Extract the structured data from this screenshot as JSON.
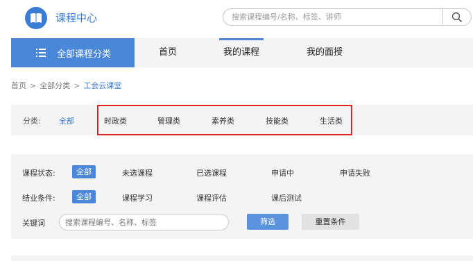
{
  "header": {
    "title": "课程中心",
    "search_placeholder": "搜索课程编号/名称、标签、讲师",
    "logo_icon": "book-icon",
    "search_icon": "search-icon"
  },
  "nav": {
    "all_categories": "全部课程分类",
    "menu_icon": "list-menu-icon",
    "items": [
      "首页",
      "我的课程",
      "我的面授"
    ],
    "active": "我的课程"
  },
  "breadcrumb": [
    "首页",
    "全部分类",
    "工会云课堂"
  ],
  "categories": {
    "label": "分类:",
    "all": "全部",
    "items": [
      "时政类",
      "管理类",
      "素养类",
      "技能类",
      "生活类"
    ]
  },
  "filters": {
    "status": {
      "label": "课程状态:",
      "active": "全部",
      "options": [
        "未选课程",
        "已选课程",
        "申请中",
        "申请失败"
      ]
    },
    "completion": {
      "label": "结业条件:",
      "active": "全部",
      "options": [
        "课程学习",
        "课程评估",
        "课后测试"
      ]
    },
    "keyword": {
      "label": "关键词",
      "placeholder": "搜索课程编号、名称、标签"
    },
    "filter_button": "筛选",
    "reset_button": "重置条件"
  },
  "colors": {
    "accent": "#4a87d9",
    "highlight_border": "#e0202a"
  }
}
